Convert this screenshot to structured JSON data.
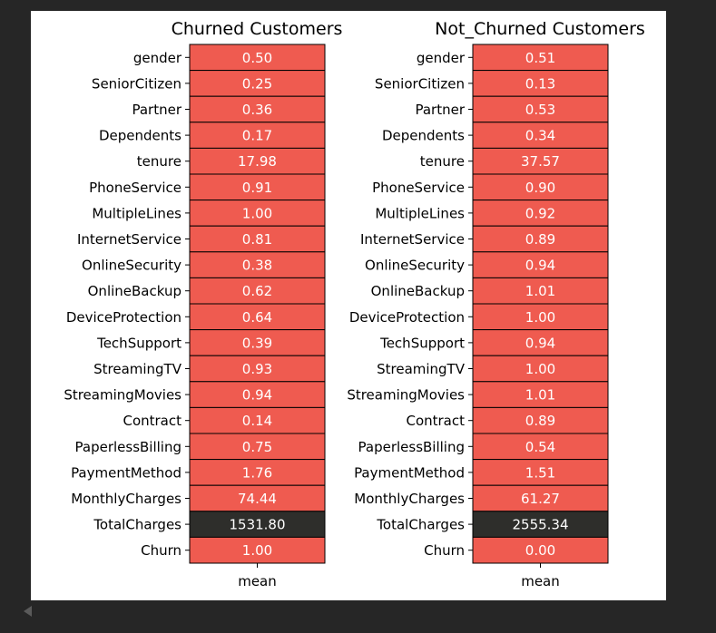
{
  "colors": {
    "background": "#262626",
    "figure": "#ffffff",
    "cell_low": "#ef5b50",
    "cell_high": "#2e2e2b",
    "cell_text": "#ffffff",
    "text": "#000000"
  },
  "chart_data": [
    {
      "type": "heatmap",
      "title": "Churned Customers",
      "column": "mean",
      "rows": [
        "gender",
        "SeniorCitizen",
        "Partner",
        "Dependents",
        "tenure",
        "PhoneService",
        "MultipleLines",
        "InternetService",
        "OnlineSecurity",
        "OnlineBackup",
        "DeviceProtection",
        "TechSupport",
        "StreamingTV",
        "StreamingMovies",
        "Contract",
        "PaperlessBilling",
        "PaymentMethod",
        "MonthlyCharges",
        "TotalCharges",
        "Churn"
      ],
      "values": [
        0.5,
        0.25,
        0.36,
        0.17,
        17.98,
        0.91,
        1.0,
        0.81,
        0.38,
        0.62,
        0.64,
        0.39,
        0.93,
        0.94,
        0.14,
        0.75,
        1.76,
        74.44,
        1531.8,
        1.0
      ],
      "labels": [
        "0.50",
        "0.25",
        "0.36",
        "0.17",
        "17.98",
        "0.91",
        "1.00",
        "0.81",
        "0.38",
        "0.62",
        "0.64",
        "0.39",
        "0.93",
        "0.94",
        "0.14",
        "0.75",
        "1.76",
        "74.44",
        "1531.80",
        "1.00"
      ]
    },
    {
      "type": "heatmap",
      "title": "Not_Churned Customers",
      "column": "mean",
      "rows": [
        "gender",
        "SeniorCitizen",
        "Partner",
        "Dependents",
        "tenure",
        "PhoneService",
        "MultipleLines",
        "InternetService",
        "OnlineSecurity",
        "OnlineBackup",
        "DeviceProtection",
        "TechSupport",
        "StreamingTV",
        "StreamingMovies",
        "Contract",
        "PaperlessBilling",
        "PaymentMethod",
        "MonthlyCharges",
        "TotalCharges",
        "Churn"
      ],
      "values": [
        0.51,
        0.13,
        0.53,
        0.34,
        37.57,
        0.9,
        0.92,
        0.89,
        0.94,
        1.01,
        1.0,
        0.94,
        1.0,
        1.01,
        0.89,
        0.54,
        1.51,
        61.27,
        2555.34,
        0.0
      ],
      "labels": [
        "0.51",
        "0.13",
        "0.53",
        "0.34",
        "37.57",
        "0.90",
        "0.92",
        "0.89",
        "0.94",
        "1.01",
        "1.00",
        "0.94",
        "1.00",
        "1.01",
        "0.89",
        "0.54",
        "1.51",
        "61.27",
        "2555.34",
        "0.00"
      ]
    }
  ]
}
